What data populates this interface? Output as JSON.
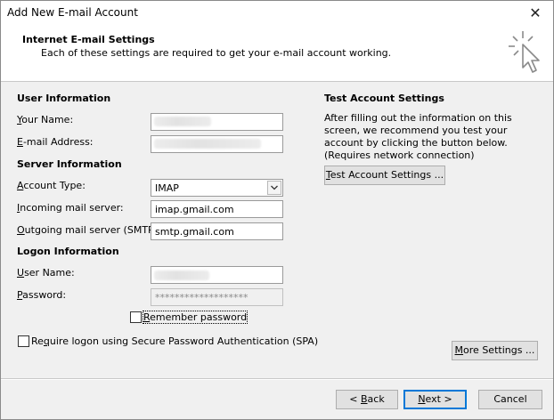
{
  "window": {
    "title": "Add New E-mail Account",
    "close_glyph": "✕"
  },
  "header": {
    "title": "Internet E-mail Settings",
    "subtitle": "Each of these settings are required to get your e-mail account working.",
    "icon": "click-cursor-icon"
  },
  "user_info": {
    "heading": "User Information",
    "your_name": {
      "label_acc": "Y",
      "label_rest": "our Name:",
      "value": ""
    },
    "email": {
      "label_acc": "E",
      "label_rest": "-mail Address:",
      "value": ""
    }
  },
  "server_info": {
    "heading": "Server Information",
    "account_type": {
      "label_pre": "",
      "label_acc": "A",
      "label_rest": "ccount Type:",
      "value": "IMAP"
    },
    "incoming": {
      "label_pre": "",
      "label_acc": "I",
      "label_rest": "ncoming mail server:",
      "value": "imap.gmail.com"
    },
    "outgoing": {
      "label_pre": "",
      "label_acc": "O",
      "label_rest": "utgoing mail server (SMTP):",
      "value": "smtp.gmail.com"
    }
  },
  "logon_info": {
    "heading": "Logon Information",
    "user_name": {
      "label_acc": "U",
      "label_rest": "ser Name:",
      "value": ""
    },
    "password": {
      "label_acc": "P",
      "label_rest": "assword:",
      "value": "*******************"
    },
    "remember": {
      "label_acc": "R",
      "label_rest": "emember password",
      "checked": false
    },
    "spa": {
      "label_pre": "Re",
      "label_acc": "q",
      "label_rest": "uire logon using Secure Password Authentication (SPA)",
      "checked": false
    }
  },
  "test": {
    "heading": "Test Account Settings",
    "description": "After filling out the information on this screen, we recommend you test your account by clicking the button below. (Requires network connection)",
    "button_acc": "T",
    "button_rest": "est Account Settings ..."
  },
  "more_settings": {
    "label_acc": "M",
    "label_rest": "ore Settings ..."
  },
  "footer": {
    "back_pre": "< ",
    "back_acc": "B",
    "back_rest": "ack",
    "next_acc": "N",
    "next_rest": "ext >",
    "cancel": "Cancel"
  }
}
